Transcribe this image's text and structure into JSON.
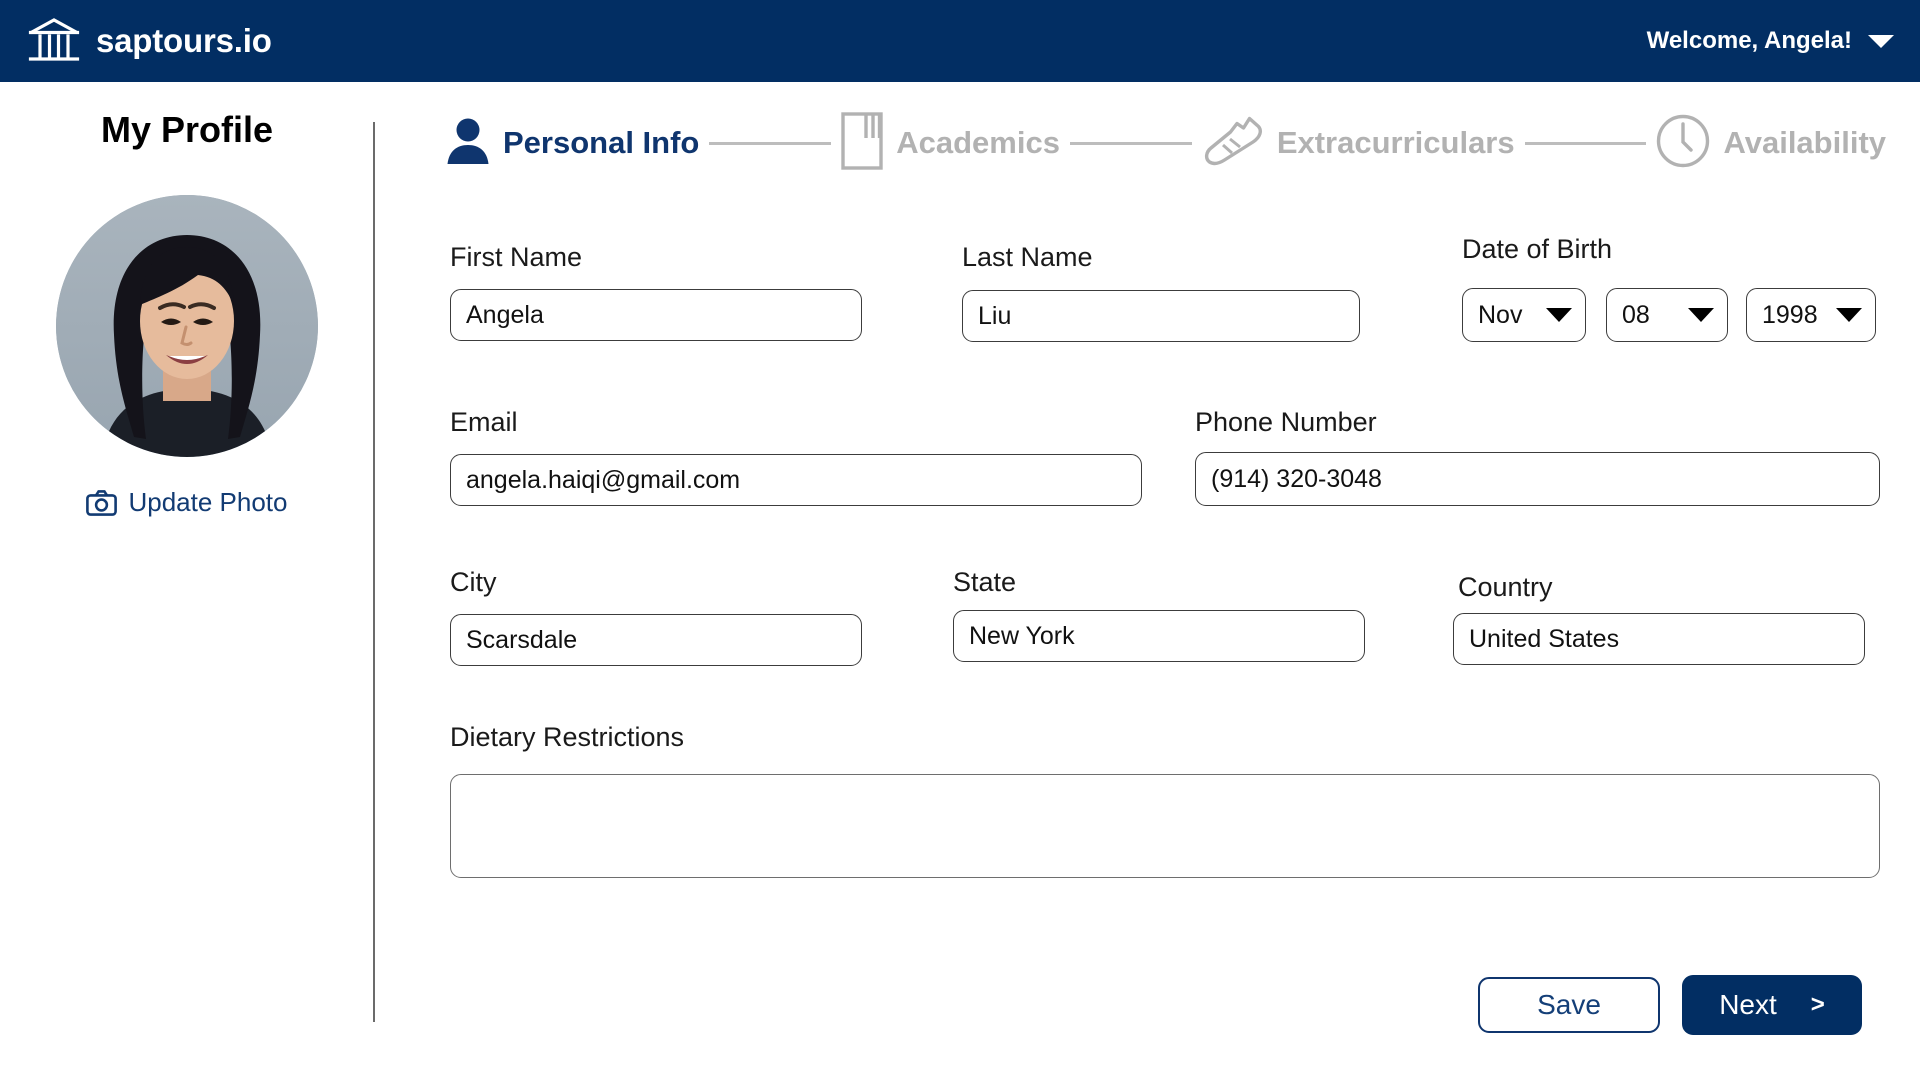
{
  "header": {
    "logo_icon": "bank-classical-building-icon",
    "brand": "saptours.io",
    "welcome": "Welcome, Angela!",
    "caret_icon": "chevron-down-icon",
    "bg_color": "#022E63"
  },
  "sidebar": {
    "title": "My Profile",
    "avatar_alt": "avatar",
    "update_photo": "Update Photo",
    "camera_icon": "camera-icon",
    "link_color": "#123B73"
  },
  "stepper": {
    "active_color": "#0F356E",
    "inactive_color": "#B2B2B2",
    "steps": [
      {
        "label": "Personal Info",
        "icon": "person-icon",
        "state": "active"
      },
      {
        "label": "Academics",
        "icon": "book-icon",
        "state": "inactive"
      },
      {
        "label": "Extracurriculars",
        "icon": "sneaker-icon",
        "state": "inactive"
      },
      {
        "label": "Availability",
        "icon": "clock-icon",
        "state": "inactive"
      }
    ]
  },
  "form": {
    "first_name": {
      "label": "First Name",
      "value": "Angela",
      "placeholder": "First Name"
    },
    "last_name": {
      "label": "Last Name",
      "value": "Liu",
      "placeholder": "Last Name"
    },
    "dob": {
      "label": "Date of Birth",
      "month": "Nov",
      "day": "08",
      "year": "1998"
    },
    "email": {
      "label": "Email",
      "value": "angela.haiqi@gmail.com",
      "placeholder": "Email"
    },
    "phone": {
      "label": "Phone Number",
      "value": "(914) 320-3048",
      "placeholder": "Phone Number"
    },
    "city": {
      "label": "City",
      "value": "Scarsdale",
      "placeholder": "City"
    },
    "state": {
      "label": "State",
      "value": "New York",
      "placeholder": "State"
    },
    "country": {
      "label": "Country",
      "value": "United States",
      "placeholder": "Country"
    },
    "dietary": {
      "label": "Dietary Restrictions",
      "value": "",
      "placeholder": ""
    }
  },
  "actions": {
    "save": "Save",
    "next": "Next",
    "next_chevron": ">"
  }
}
